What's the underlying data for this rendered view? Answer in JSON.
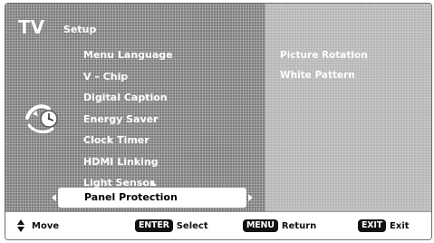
{
  "header": {
    "tv_label": "TV",
    "menu_title": "Setup"
  },
  "menu": {
    "items": [
      {
        "label": "Menu Language"
      },
      {
        "label": "V – Chip"
      },
      {
        "label": "Digital Caption"
      },
      {
        "label": "Energy Saver"
      },
      {
        "label": "Clock Timer"
      },
      {
        "label": "HDMI Linking"
      },
      {
        "label": "Light Sensor"
      }
    ],
    "selected_label": "Panel Protection"
  },
  "submenu": {
    "items": [
      {
        "label": "Picture Rotation"
      },
      {
        "label": "White Pattern"
      }
    ]
  },
  "footer": {
    "move_label": "Move",
    "enter_key": "ENTER",
    "select_label": "Select",
    "menu_key": "MENU",
    "return_label": "Return",
    "exit_key": "EXIT",
    "exit_label": "Exit"
  },
  "icons": {
    "menu_icon": "clock-icon",
    "move_icon": "up-down-arrow-icon"
  },
  "colors": {
    "menu_bg": "#8f8f8f",
    "submenu_bg": "#b4b4b4",
    "text": "#ffffff",
    "highlight": "#ffffff",
    "key_bg": "#111111"
  }
}
